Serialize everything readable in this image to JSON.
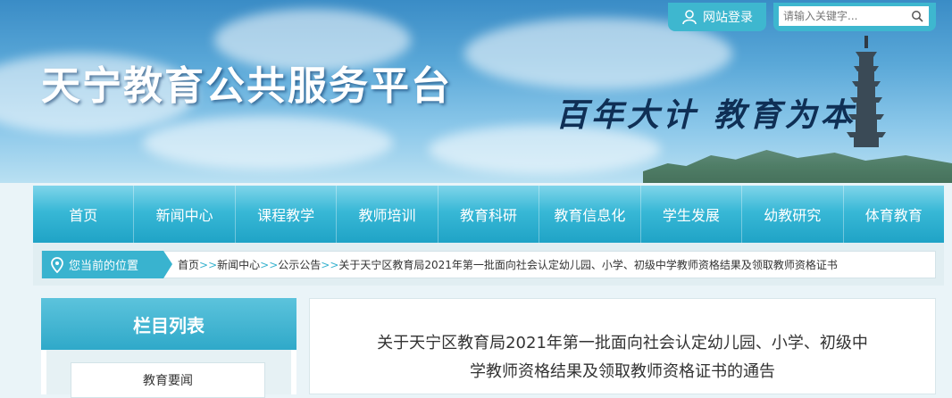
{
  "header": {
    "site_title": "天宁教育公共服务平台",
    "slogan": "百年大计 教育为本",
    "login_label": "网站登录",
    "search_placeholder": "请输入关键字..."
  },
  "nav": {
    "items": [
      {
        "label": "首页"
      },
      {
        "label": "新闻中心"
      },
      {
        "label": "课程教学"
      },
      {
        "label": "教师培训"
      },
      {
        "label": "教育科研"
      },
      {
        "label": "教育信息化"
      },
      {
        "label": "学生发展"
      },
      {
        "label": "幼教研究"
      },
      {
        "label": "体育教育"
      }
    ]
  },
  "breadcrumb": {
    "label": "您当前的位置",
    "separator": ">>",
    "items": [
      {
        "label": "首页"
      },
      {
        "label": "新闻中心"
      },
      {
        "label": "公示公告"
      },
      {
        "label": "关于天宁区教育局2021年第一批面向社会认定幼儿园、小学、初级中学教师资格结果及领取教师资格证书"
      }
    ]
  },
  "sidebar": {
    "title": "栏目列表",
    "items": [
      {
        "label": "教育要闻"
      }
    ]
  },
  "article": {
    "title_line1": "关于天宁区教育局2021年第一批面向社会认定幼儿园、小学、初级中",
    "title_line2": "学教师资格结果及领取教师资格证书的通告"
  },
  "colors": {
    "accent": "#39b3cf",
    "nav_top": "#7fd5ea",
    "nav_bottom": "#1fa3c6",
    "sky": "#5aa8d8"
  },
  "icons": {
    "login": "user-icon",
    "search": "search-icon",
    "location": "location-pin-icon"
  }
}
